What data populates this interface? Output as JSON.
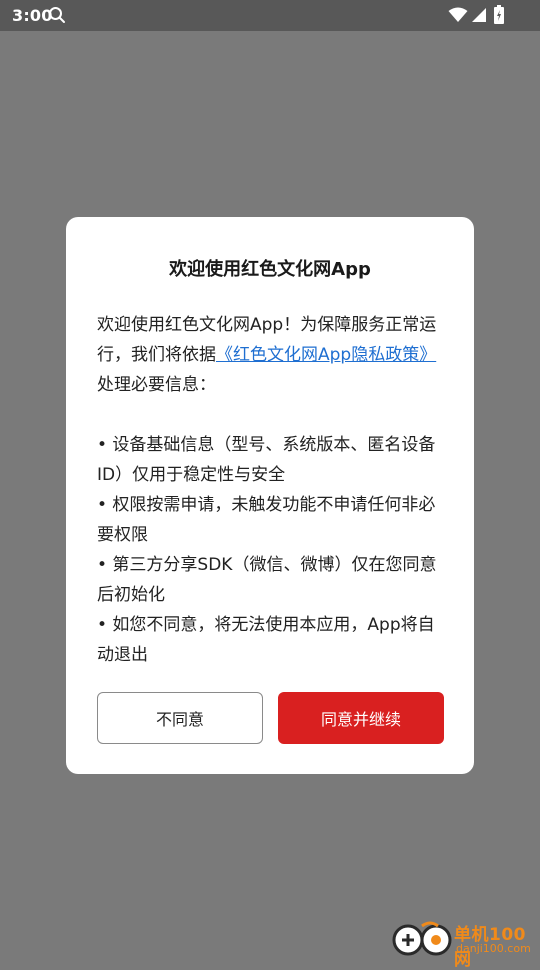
{
  "status_bar": {
    "time": "3:00",
    "icons": [
      "search-icon",
      "wifi-icon",
      "signal-icon",
      "battery-icon"
    ]
  },
  "dialog": {
    "title": "欢迎使用红色文化网App",
    "intro_prefix": "欢迎使用红色文化网App！为保障服务正常运行，我们将依据",
    "policy_link": "《红色文化网App隐私政策》",
    "intro_suffix": "处理必要信息：",
    "bullets": [
      "• 设备基础信息（型号、系统版本、匿名设备ID）仅用于稳定性与安全",
      "• 权限按需申请，未触发功能不申请任何非必要权限",
      "• 第三方分享SDK（微信、微博）仅在您同意后初始化",
      "• 如您不同意，将无法使用本应用，App将自动退出"
    ],
    "decline_label": "不同意",
    "accept_label": "同意并继续"
  },
  "watermark": {
    "name": "单机100网",
    "domain": "danji100.com"
  },
  "colors": {
    "overlay": "#7a7a7a",
    "status_bar": "#585858",
    "accent": "#d92020",
    "link": "#1f6fd1",
    "watermark": "#f08a1a"
  }
}
